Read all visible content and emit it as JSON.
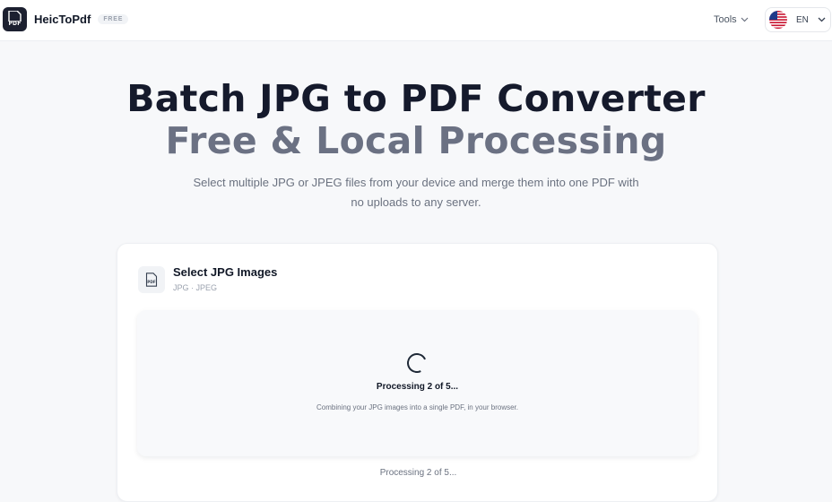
{
  "header": {
    "logo_text": "PDF",
    "brand": "HeicToPdf",
    "badge": "FREE",
    "tools_label": "Tools",
    "language": "EN"
  },
  "hero": {
    "title": "Batch JPG to PDF Converter",
    "subtitle": "Free & Local Processing",
    "description": "Select multiple JPG or JPEG files from your device and merge them into one PDF with no uploads to any server."
  },
  "card": {
    "icon_text": "PDF",
    "title": "Select JPG Images",
    "formats": "JPG · JPEG",
    "progress_title": "Processing 2 of 5...",
    "progress_description": "Combining your JPG images into a single PDF, in your browser.",
    "status": "Processing 2 of 5..."
  },
  "colors": {
    "accent_dark": "#1c2030",
    "subtitle_gray": "#6b7183"
  }
}
